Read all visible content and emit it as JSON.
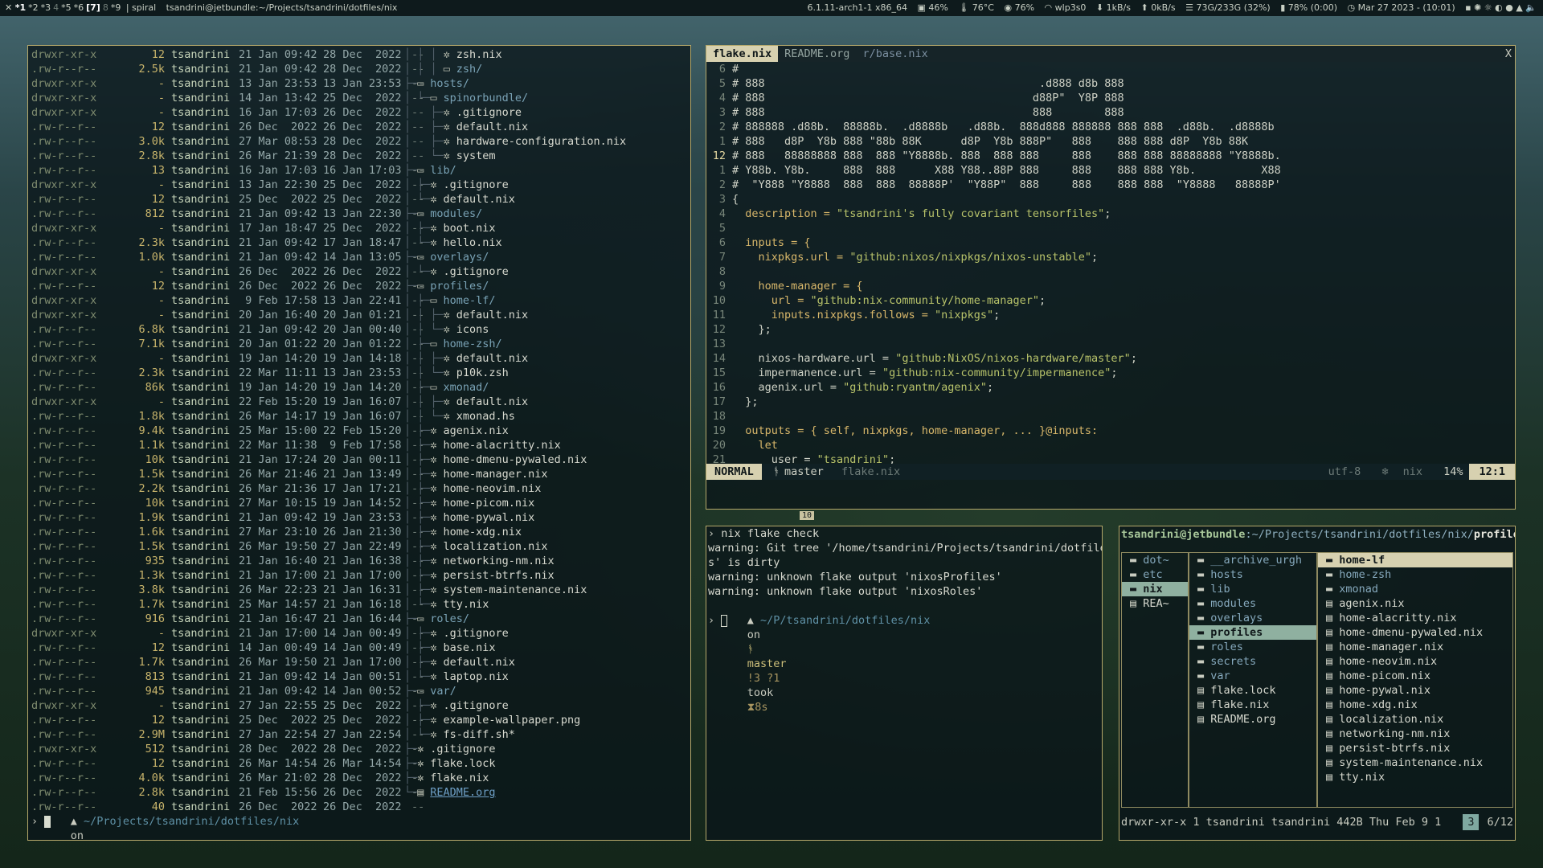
{
  "topbar": {
    "workspaces": [
      {
        "label": "*1",
        "state": "active"
      },
      {
        "label": "*2",
        "state": "normal"
      },
      {
        "label": "*3",
        "state": "normal"
      },
      {
        "label": "4",
        "state": "dim"
      },
      {
        "label": "*5",
        "state": "normal"
      },
      {
        "label": "*6",
        "state": "normal"
      },
      {
        "label": "[7]",
        "state": "active"
      },
      {
        "label": "8",
        "state": "dim"
      },
      {
        "label": "*9",
        "state": "normal"
      }
    ],
    "layout": "spiral",
    "window_title": "tsandrini@jetbundle:~/Projects/tsandrini/dotfiles/nix",
    "kernel": "6.1.11-arch1-1 x86_64",
    "cpu": "46%",
    "temp": "76°C",
    "mem_pct": "76%",
    "wifi": "wlp3s0",
    "net_down": "1kB/s",
    "net_up": "0kB/s",
    "disk": "73G/233G (32%)",
    "battery": "78% (0:00)",
    "datetime": "Mar 27 2023 - (10:01)"
  },
  "ls_rows": [
    [
      "drwxr-xr-x",
      "12",
      "tsandrini",
      "21 Jan 09:42",
      "28 Dec  2022",
      "--"
    ],
    [
      ".rw-r--r--",
      "2.5k",
      "tsandrini",
      "21 Jan 09:42",
      "28 Dec  2022",
      "--"
    ],
    [
      "drwxr-xr-x",
      "-",
      "tsandrini",
      "13 Jan 23:53",
      "13 Jan 23:53",
      "--"
    ],
    [
      "drwxr-xr-x",
      "-",
      "tsandrini",
      "14 Jan 13:42",
      "25 Dec  2022",
      "--"
    ],
    [
      "drwxr-xr-x",
      "-",
      "tsandrini",
      "16 Jan 17:03",
      "26 Dec  2022",
      "--"
    ],
    [
      ".rw-r--r--",
      "12",
      "tsandrini",
      "26 Dec  2022",
      "26 Dec  2022",
      "--"
    ],
    [
      ".rw-r--r--",
      "3.0k",
      "tsandrini",
      "27 Mar 08:53",
      "28 Dec  2022",
      "--"
    ],
    [
      ".rw-r--r--",
      "2.8k",
      "tsandrini",
      "26 Mar 21:39",
      "28 Dec  2022",
      "--"
    ],
    [
      ".rw-r--r--",
      "13",
      "tsandrini",
      "16 Jan 17:03",
      "16 Jan 17:03",
      "--"
    ],
    [
      "drwxr-xr-x",
      "-",
      "tsandrini",
      "13 Jan 22:30",
      "25 Dec  2022",
      "--"
    ],
    [
      ".rw-r--r--",
      "12",
      "tsandrini",
      "25 Dec  2022",
      "25 Dec  2022",
      "--"
    ],
    [
      ".rw-r--r--",
      "812",
      "tsandrini",
      "21 Jan 09:42",
      "13 Jan 22:30",
      "--"
    ],
    [
      "drwxr-xr-x",
      "-",
      "tsandrini",
      "17 Jan 18:47",
      "25 Dec  2022",
      "--"
    ],
    [
      ".rw-r--r--",
      "2.3k",
      "tsandrini",
      "21 Jan 09:42",
      "17 Jan 18:47",
      "--"
    ],
    [
      ".rw-r--r--",
      "1.0k",
      "tsandrini",
      "21 Jan 09:42",
      "14 Jan 13:05",
      "--"
    ],
    [
      "drwxr-xr-x",
      "-",
      "tsandrini",
      "26 Dec  2022",
      "26 Dec  2022",
      "--"
    ],
    [
      ".rw-r--r--",
      "12",
      "tsandrini",
      "26 Dec  2022",
      "26 Dec  2022",
      "--"
    ],
    [
      "drwxr-xr-x",
      "-",
      "tsandrini",
      " 9 Feb 17:58",
      "13 Jan 22:41",
      "--"
    ],
    [
      "drwxr-xr-x",
      "-",
      "tsandrini",
      "20 Jan 16:40",
      "20 Jan 01:21",
      "--"
    ],
    [
      ".rw-r--r--",
      "6.8k",
      "tsandrini",
      "21 Jan 09:42",
      "20 Jan 00:40",
      "--"
    ],
    [
      ".rw-r--r--",
      "7.1k",
      "tsandrini",
      "20 Jan 01:22",
      "20 Jan 01:22",
      "--"
    ],
    [
      "drwxr-xr-x",
      "-",
      "tsandrini",
      "19 Jan 14:20",
      "19 Jan 14:18",
      "--"
    ],
    [
      ".rw-r--r--",
      "2.3k",
      "tsandrini",
      "22 Mar 11:11",
      "13 Jan 23:53",
      "--"
    ],
    [
      ".rw-r--r--",
      "86k",
      "tsandrini",
      "19 Jan 14:20",
      "19 Jan 14:20",
      "--"
    ],
    [
      "drwxr-xr-x",
      "-",
      "tsandrini",
      "22 Feb 15:20",
      "19 Jan 16:07",
      "--"
    ],
    [
      ".rw-r--r--",
      "1.8k",
      "tsandrini",
      "26 Mar 14:17",
      "19 Jan 16:07",
      "--"
    ],
    [
      ".rw-r--r--",
      "9.4k",
      "tsandrini",
      "25 Mar 15:00",
      "22 Feb 15:20",
      "--"
    ],
    [
      ".rw-r--r--",
      "1.1k",
      "tsandrini",
      "22 Mar 11:38",
      " 9 Feb 17:58",
      "--"
    ],
    [
      ".rw-r--r--",
      "10k",
      "tsandrini",
      "21 Jan 17:24",
      "20 Jan 00:11",
      "--"
    ],
    [
      ".rw-r--r--",
      "1.5k",
      "tsandrini",
      "26 Mar 21:46",
      "21 Jan 13:49",
      "--"
    ],
    [
      ".rw-r--r--",
      "2.2k",
      "tsandrini",
      "26 Mar 21:36",
      "17 Jan 17:21",
      "--"
    ],
    [
      ".rw-r--r--",
      "10k",
      "tsandrini",
      "27 Mar 10:15",
      "19 Jan 14:52",
      "--"
    ],
    [
      ".rw-r--r--",
      "1.9k",
      "tsandrini",
      "21 Jan 09:42",
      "19 Jan 23:53",
      "--"
    ],
    [
      ".rw-r--r--",
      "1.6k",
      "tsandrini",
      "27 Mar 23:10",
      "26 Jan 21:30",
      "--"
    ],
    [
      ".rw-r--r--",
      "1.5k",
      "tsandrini",
      "26 Mar 19:50",
      "27 Jan 22:49",
      "--"
    ],
    [
      ".rw-r--r--",
      "935",
      "tsandrini",
      "21 Jan 16:40",
      "21 Jan 16:38",
      "--"
    ],
    [
      ".rw-r--r--",
      "1.3k",
      "tsandrini",
      "21 Jan 17:00",
      "21 Jan 17:00",
      "--"
    ],
    [
      ".rw-r--r--",
      "3.8k",
      "tsandrini",
      "26 Mar 22:23",
      "21 Jan 16:31",
      "--"
    ],
    [
      ".rw-r--r--",
      "1.7k",
      "tsandrini",
      "25 Mar 14:57",
      "21 Jan 16:18",
      "--"
    ],
    [
      ".rw-r--r--",
      "916",
      "tsandrini",
      "21 Jan 16:47",
      "21 Jan 16:44",
      "--"
    ],
    [
      "drwxr-xr-x",
      "-",
      "tsandrini",
      "21 Jan 17:00",
      "14 Jan 00:49",
      "--"
    ],
    [
      ".rw-r--r--",
      "12",
      "tsandrini",
      "14 Jan 00:49",
      "14 Jan 00:49",
      "--"
    ],
    [
      ".rw-r--r--",
      "1.7k",
      "tsandrini",
      "26 Mar 19:50",
      "21 Jan 17:00",
      "--"
    ],
    [
      ".rw-r--r--",
      "813",
      "tsandrini",
      "21 Jan 09:42",
      "14 Jan 00:51",
      "--"
    ],
    [
      ".rw-r--r--",
      "945",
      "tsandrini",
      "21 Jan 09:42",
      "14 Jan 00:52",
      "--"
    ],
    [
      "drwxr-xr-x",
      "-",
      "tsandrini",
      "27 Jan 22:55",
      "25 Dec  2022",
      "--"
    ],
    [
      ".rw-r--r--",
      "12",
      "tsandrini",
      "25 Dec  2022",
      "25 Dec  2022",
      "--"
    ],
    [
      ".rw-r--r--",
      "2.9M",
      "tsandrini",
      "27 Jan 22:54",
      "27 Jan 22:54",
      "--"
    ],
    [
      ".rwxr-xr-x",
      "512",
      "tsandrini",
      "28 Dec  2022",
      "28 Dec  2022",
      "--"
    ],
    [
      ".rw-r--r--",
      "12",
      "tsandrini",
      "26 Mar 14:54",
      "26 Mar 14:54",
      "--"
    ],
    [
      ".rw-r--r--",
      "4.0k",
      "tsandrini",
      "26 Mar 21:02",
      "28 Dec  2022",
      "--"
    ],
    [
      ".rw-r--r--",
      "2.8k",
      "tsandrini",
      "21 Feb 15:56",
      "26 Dec  2022",
      "--"
    ],
    [
      ".rw-r--r--",
      "40",
      "tsandrini",
      "26 Dec  2022",
      "26 Dec  2022",
      "--"
    ]
  ],
  "tree_rows": [
    {
      "indent": 4,
      "type": "file",
      "name": "zsh.nix",
      "guide": "│ │ │ "
    },
    {
      "indent": 4,
      "type": "dir",
      "name": "zsh/",
      "guide": "│ │ │ "
    },
    {
      "indent": 1,
      "type": "dir",
      "name": "hosts/",
      "guide": "├─"
    },
    {
      "indent": 2,
      "type": "dir",
      "name": "spinorbundle/",
      "guide": "│ └─"
    },
    {
      "indent": 3,
      "type": "file",
      "name": ".gitignore",
      "guide": "│   ├─"
    },
    {
      "indent": 3,
      "type": "file",
      "name": "default.nix",
      "guide": "│   ├─"
    },
    {
      "indent": 3,
      "type": "file",
      "name": "hardware-configuration.nix",
      "guide": "│   ├─"
    },
    {
      "indent": 3,
      "type": "file",
      "name": "system",
      "guide": "│   └─"
    },
    {
      "indent": 1,
      "type": "dir",
      "name": "lib/",
      "guide": "├─"
    },
    {
      "indent": 2,
      "type": "file",
      "name": ".gitignore",
      "guide": "│ ├─"
    },
    {
      "indent": 2,
      "type": "file",
      "name": "default.nix",
      "guide": "│ └─"
    },
    {
      "indent": 1,
      "type": "dir",
      "name": "modules/",
      "guide": "├─"
    },
    {
      "indent": 2,
      "type": "file",
      "name": "boot.nix",
      "guide": "│ ├─"
    },
    {
      "indent": 2,
      "type": "file",
      "name": "hello.nix",
      "guide": "│ └─"
    },
    {
      "indent": 1,
      "type": "dir",
      "name": "overlays/",
      "guide": "├─"
    },
    {
      "indent": 2,
      "type": "file",
      "name": ".gitignore",
      "guide": "│ └─"
    },
    {
      "indent": 1,
      "type": "dir",
      "name": "profiles/",
      "guide": "├─"
    },
    {
      "indent": 2,
      "type": "dir",
      "name": "home-lf/",
      "guide": "│ ├─"
    },
    {
      "indent": 3,
      "type": "file",
      "name": "default.nix",
      "guide": "│ │ ├─"
    },
    {
      "indent": 3,
      "type": "file",
      "name": "icons",
      "guide": "│ │ └─"
    },
    {
      "indent": 2,
      "type": "dir",
      "name": "home-zsh/",
      "guide": "│ ├─"
    },
    {
      "indent": 3,
      "type": "file",
      "name": "default.nix",
      "guide": "│ │ ├─"
    },
    {
      "indent": 3,
      "type": "file",
      "name": "p10k.zsh",
      "guide": "│ │ └─"
    },
    {
      "indent": 2,
      "type": "dir",
      "name": "xmonad/",
      "guide": "│ ├─"
    },
    {
      "indent": 3,
      "type": "file",
      "name": "default.nix",
      "guide": "│ │ ├─"
    },
    {
      "indent": 3,
      "type": "file",
      "name": "xmonad.hs",
      "guide": "│ │ └─"
    },
    {
      "indent": 2,
      "type": "file",
      "name": "agenix.nix",
      "guide": "│ ├─"
    },
    {
      "indent": 2,
      "type": "file",
      "name": "home-alacritty.nix",
      "guide": "│ ├─"
    },
    {
      "indent": 2,
      "type": "file",
      "name": "home-dmenu-pywaled.nix",
      "guide": "│ ├─"
    },
    {
      "indent": 2,
      "type": "file",
      "name": "home-manager.nix",
      "guide": "│ ├─"
    },
    {
      "indent": 2,
      "type": "file",
      "name": "home-neovim.nix",
      "guide": "│ ├─"
    },
    {
      "indent": 2,
      "type": "file",
      "name": "home-picom.nix",
      "guide": "│ ├─"
    },
    {
      "indent": 2,
      "type": "file",
      "name": "home-pywal.nix",
      "guide": "│ ├─"
    },
    {
      "indent": 2,
      "type": "file",
      "name": "home-xdg.nix",
      "guide": "│ ├─"
    },
    {
      "indent": 2,
      "type": "file",
      "name": "localization.nix",
      "guide": "│ ├─"
    },
    {
      "indent": 2,
      "type": "file",
      "name": "networking-nm.nix",
      "guide": "│ ├─"
    },
    {
      "indent": 2,
      "type": "file",
      "name": "persist-btrfs.nix",
      "guide": "│ ├─"
    },
    {
      "indent": 2,
      "type": "file",
      "name": "system-maintenance.nix",
      "guide": "│ ├─"
    },
    {
      "indent": 2,
      "type": "file",
      "name": "tty.nix",
      "guide": "│ └─"
    },
    {
      "indent": 1,
      "type": "dir",
      "name": "roles/",
      "guide": "├─"
    },
    {
      "indent": 2,
      "type": "file",
      "name": ".gitignore",
      "guide": "│ ├─"
    },
    {
      "indent": 2,
      "type": "file",
      "name": "base.nix",
      "guide": "│ ├─"
    },
    {
      "indent": 2,
      "type": "file",
      "name": "default.nix",
      "guide": "│ ├─"
    },
    {
      "indent": 2,
      "type": "file",
      "name": "laptop.nix",
      "guide": "│ └─"
    },
    {
      "indent": 1,
      "type": "dir",
      "name": "var/",
      "guide": "├─"
    },
    {
      "indent": 2,
      "type": "file",
      "name": ".gitignore",
      "guide": "│ ├─"
    },
    {
      "indent": 2,
      "type": "file",
      "name": "example-wallpaper.png",
      "guide": "│ ├─"
    },
    {
      "indent": 2,
      "type": "file",
      "name": "fs-diff.sh*",
      "guide": "│ └─"
    },
    {
      "indent": 1,
      "type": "file",
      "name": ".gitignore",
      "guide": "├─"
    },
    {
      "indent": 1,
      "type": "file",
      "name": "flake.lock",
      "guide": "├─"
    },
    {
      "indent": 1,
      "type": "file",
      "name": "flake.nix",
      "guide": "├─"
    },
    {
      "indent": 1,
      "type": "link",
      "name": "README.org",
      "guide": "└─"
    }
  ],
  "shell_prompt": {
    "dir": "~/Projects/tsandrini/dotfiles/nix",
    "on": "on",
    "branch": "master",
    "status": "!3"
  },
  "editor": {
    "tabs": [
      "flake.nix",
      "README.org",
      "r/base.nix"
    ],
    "close": "X",
    "lines": [
      {
        "n": "6",
        "t": "#"
      },
      {
        "n": "5",
        "t": "# 888                                          .d888 d8b 888"
      },
      {
        "n": "4",
        "t": "# 888                                         d88P\"  Y8P 888"
      },
      {
        "n": "3",
        "t": "# 888                                         888        888"
      },
      {
        "n": "2",
        "t": "# 888888 .d88b.  88888b.  .d8888b   .d88b.  888d888 888888 888 888  .d88b.  .d8888b"
      },
      {
        "n": "1",
        "t": "# 888   d8P  Y8b 888 \"88b 88K      d8P  Y8b 888P\"   888    888 888 d8P  Y8b 88K"
      },
      {
        "n": "12",
        "t": "# 888   88888888 888  888 \"Y8888b. 888  888 888     888    888 888 88888888 \"Y8888b.",
        "cur": true
      },
      {
        "n": "1",
        "t": "# Y88b. Y8b.     888  888      X88 Y88..88P 888     888    888 888 Y8b.          X88"
      },
      {
        "n": "2",
        "t": "#  \"Y888 \"Y8888  888  888  88888P'  \"Y88P\"  888     888    888 888  \"Y8888   88888P'"
      },
      {
        "n": "3",
        "t": "{"
      },
      {
        "n": "4",
        "t": "  description = \"tsandrini's fully covariant tensorfiles\";"
      },
      {
        "n": "5",
        "t": ""
      },
      {
        "n": "6",
        "t": "  inputs = {"
      },
      {
        "n": "7",
        "t": "    nixpkgs.url = \"github:nixos/nixpkgs/nixos-unstable\";"
      },
      {
        "n": "8",
        "t": ""
      },
      {
        "n": "9",
        "t": "    home-manager = {"
      },
      {
        "n": "10",
        "t": "      url = \"github:nix-community/home-manager\";"
      },
      {
        "n": "11",
        "t": "      inputs.nixpkgs.follows = \"nixpkgs\";"
      },
      {
        "n": "12",
        "t": "    };"
      },
      {
        "n": "13",
        "t": ""
      },
      {
        "n": "14",
        "t": "    nixos-hardware.url = \"github:NixOS/nixos-hardware/master\";"
      },
      {
        "n": "15",
        "t": "    impermanence.url = \"github:nix-community/impermanence\";"
      },
      {
        "n": "16",
        "t": "    agenix.url = \"github:ryantm/agenix\";"
      },
      {
        "n": "17",
        "t": "  };"
      },
      {
        "n": "18",
        "t": ""
      },
      {
        "n": "19",
        "t": "  outputs = { self, nixpkgs, home-manager, ... }@inputs:"
      },
      {
        "n": "20",
        "t": "    let"
      },
      {
        "n": "21",
        "t": "      user = \"tsandrini\";"
      }
    ],
    "status": {
      "mode": "NORMAL",
      "branch": "master",
      "file": "flake.nix",
      "encoding": "utf-8",
      "filetype": "nix",
      "percent": "14%",
      "position": "12:1"
    }
  },
  "terminal": {
    "tag": "10",
    "lines": [
      {
        "kind": "cmd",
        "t": "nix flake check"
      },
      {
        "kind": "out",
        "t": "warning: Git tree '/home/tsandrini/Projects/tsandrini/dotfile"
      },
      {
        "kind": "out",
        "t": "s' is dirty"
      },
      {
        "kind": "out",
        "t": "warning: unknown flake output 'nixosProfiles'"
      },
      {
        "kind": "out",
        "t": "warning: unknown flake output 'nixosRoles'"
      }
    ],
    "prompt": {
      "dir": "~/P/tsandrini/dotfiles/nix",
      "on": "on",
      "branch": "master",
      "status": "!3 ?1",
      "took": "took",
      "time": "8s"
    }
  },
  "lf": {
    "host": "tsandrini@jetbundle",
    "path": ":~/Projects/tsandrini/dotfiles/nix/",
    "current": "profile",
    "col1": [
      {
        "name": "dot~",
        "sel": false
      },
      {
        "name": "etc",
        "sel": false
      },
      {
        "name": "nix",
        "sel": true
      },
      {
        "name": "REA~",
        "sel": false,
        "file": true
      }
    ],
    "col2": [
      {
        "name": "__archive_urgh",
        "sel": false
      },
      {
        "name": "hosts",
        "sel": false
      },
      {
        "name": "lib",
        "sel": false
      },
      {
        "name": "modules",
        "sel": false
      },
      {
        "name": "overlays",
        "sel": false
      },
      {
        "name": "profiles",
        "sel": true
      },
      {
        "name": "roles",
        "sel": false
      },
      {
        "name": "secrets",
        "sel": false
      },
      {
        "name": "var",
        "sel": false
      },
      {
        "name": "flake.lock",
        "sel": false,
        "file": true
      },
      {
        "name": "flake.nix",
        "sel": false,
        "file": true
      },
      {
        "name": "README.org",
        "sel": false,
        "file": true
      }
    ],
    "col3": [
      {
        "name": "home-lf",
        "sel": true
      },
      {
        "name": "home-zsh",
        "sel": false
      },
      {
        "name": "xmonad",
        "sel": false
      },
      {
        "name": "agenix.nix",
        "sel": false,
        "file": true
      },
      {
        "name": "home-alacritty.nix",
        "sel": false,
        "file": true
      },
      {
        "name": "home-dmenu-pywaled.nix",
        "sel": false,
        "file": true
      },
      {
        "name": "home-manager.nix",
        "sel": false,
        "file": true
      },
      {
        "name": "home-neovim.nix",
        "sel": false,
        "file": true
      },
      {
        "name": "home-picom.nix",
        "sel": false,
        "file": true
      },
      {
        "name": "home-pywal.nix",
        "sel": false,
        "file": true
      },
      {
        "name": "home-xdg.nix",
        "sel": false,
        "file": true
      },
      {
        "name": "localization.nix",
        "sel": false,
        "file": true
      },
      {
        "name": "networking-nm.nix",
        "sel": false,
        "file": true
      },
      {
        "name": "persist-btrfs.nix",
        "sel": false,
        "file": true
      },
      {
        "name": "system-maintenance.nix",
        "sel": false,
        "file": true
      },
      {
        "name": "tty.nix",
        "sel": false,
        "file": true
      }
    ],
    "footer": "drwxr-xr-x 1 tsandrini tsandrini 442B Thu Feb  9 1",
    "badge": "3",
    "count": "6/12"
  }
}
